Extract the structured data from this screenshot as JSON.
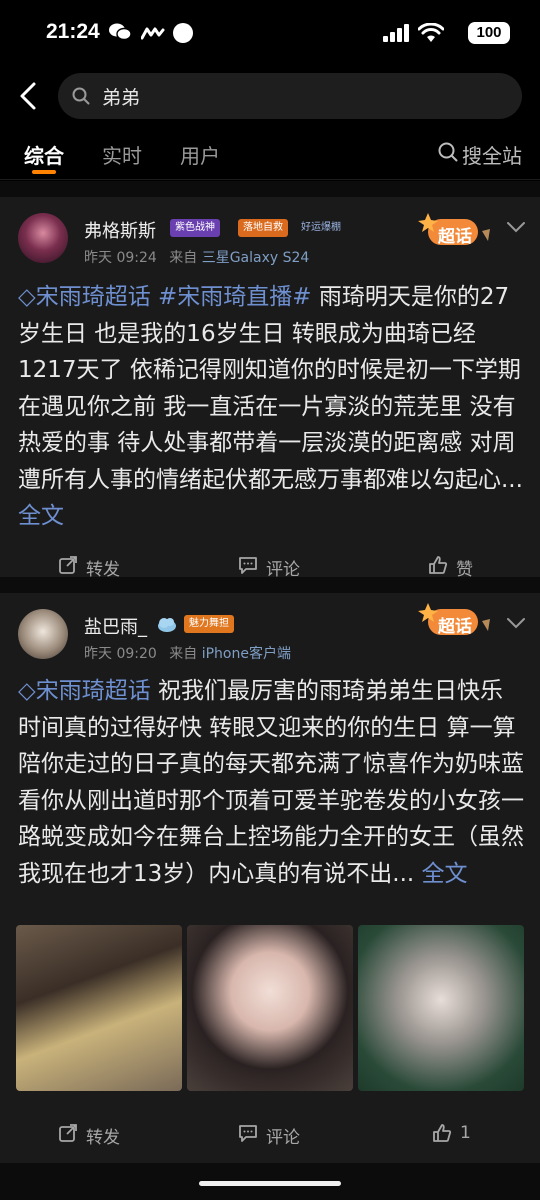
{
  "status_bar": {
    "time": "21:24",
    "battery": "100"
  },
  "search": {
    "query": "弟弟"
  },
  "tabs": [
    {
      "label": "综合",
      "active": true
    },
    {
      "label": "实时",
      "active": false
    },
    {
      "label": "用户",
      "active": false
    }
  ],
  "site_search_label": "搜全站",
  "posts": [
    {
      "username": "弗格斯斯",
      "badges": [
        "紫色战神",
        "落地自救",
        "好运爆棚"
      ],
      "time": "昨天 09:24",
      "source_prefix": "来自",
      "source": "三星Galaxy S24",
      "chaohua_label": "超话",
      "topics": [
        "◇宋雨琦超话",
        "#宋雨琦直播#"
      ],
      "text": "雨琦明天是你的27岁生日 也是我的16岁生日 转眼成为曲琦已经1217天了 依稀记得刚知道你的时候是初一下学期 在遇见你之前 我一直活在一片寡淡的荒芜里 没有热爱的事 待人处事都带着一层淡漠的距离感 对周遭所有人事的情绪起伏都无感万事都难以勾起心...",
      "more_label": "全文",
      "actions": {
        "repost": "转发",
        "comment": "评论",
        "like": "赞"
      }
    },
    {
      "username": "盐巴雨_",
      "badges": [
        "魅力舞担"
      ],
      "time": "昨天 09:20",
      "source_prefix": "来自",
      "source": "iPhone客户端",
      "chaohua_label": "超话",
      "topics": [
        "◇宋雨琦超话"
      ],
      "text": "祝我们最厉害的雨琦弟弟生日快乐时间真的过得好快 转眼又迎来的你的生日 算一算陪你走过的日子真的每天都充满了惊喜作为奶味蓝 看你从刚出道时那个顶着可爱羊驼卷发的小女孩一路蜕变成如今在舞台上控场能力全开的女王（虽然我现在也才13岁）内心真的有说不出...",
      "more_label": "全文",
      "actions": {
        "repost": "转发",
        "comment": "评论",
        "like": "1"
      }
    }
  ],
  "colors": {
    "accent": "#ff8200",
    "link": "#6e8fd0",
    "card_bg": "#1a1a1a"
  }
}
